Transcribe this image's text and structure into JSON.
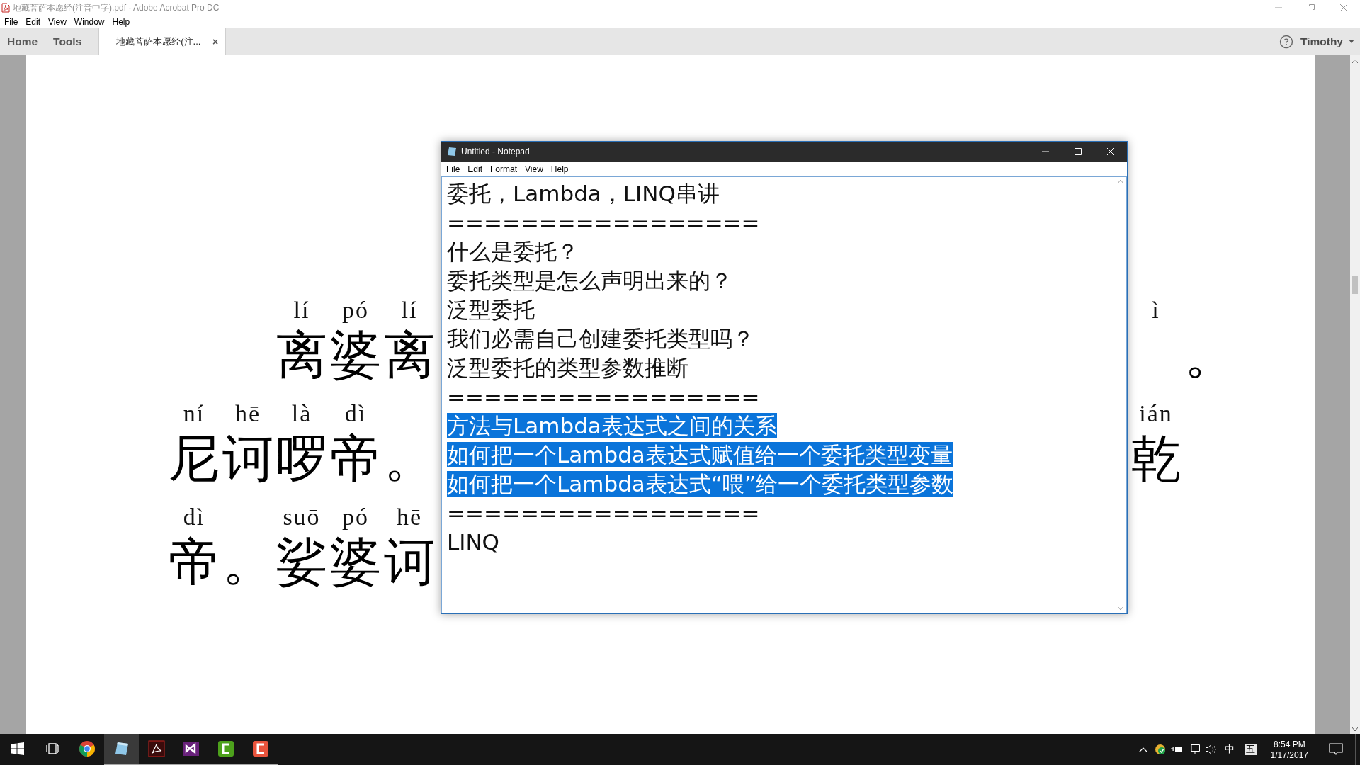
{
  "window": {
    "title": "地藏菩萨本愿经(注音中字).pdf - Adobe Acrobat Pro DC"
  },
  "menu": [
    "File",
    "Edit",
    "View",
    "Window",
    "Help"
  ],
  "nav_tabs": [
    {
      "label": "Home",
      "selected": false
    },
    {
      "label": "Tools",
      "selected": false
    }
  ],
  "doc_tab": {
    "label": "地藏菩萨本愿经(注...",
    "close": "×"
  },
  "account": {
    "name": "Timothy"
  },
  "pdf_page": {
    "left_rows": [
      {
        "cells": [
          {
            "pinyin": "lí",
            "hanzi": "离"
          },
          {
            "pinyin": "pó",
            "hanzi": "婆"
          },
          {
            "pinyin": "lí",
            "hanzi": "离"
          }
        ]
      },
      {
        "cells": [
          {
            "pinyin": "ní",
            "hanzi": "尼"
          },
          {
            "pinyin": "hē",
            "hanzi": "诃"
          },
          {
            "pinyin": "là",
            "hanzi": "啰"
          },
          {
            "pinyin": "dì",
            "hanzi": "帝"
          },
          {
            "hanzi": "。"
          }
        ]
      },
      {
        "cells": [
          {
            "pinyin": "dì",
            "hanzi": "帝"
          },
          {
            "hanzi": "。"
          },
          {
            "pinyin": "suō",
            "hanzi": "娑"
          },
          {
            "pinyin": "pó",
            "hanzi": "婆"
          },
          {
            "pinyin": "hē",
            "hanzi": "诃"
          }
        ]
      }
    ],
    "right_rows": [
      {
        "cells": [
          {
            "pinyin": "ì"
          },
          {
            "hanzi": "。"
          }
        ]
      },
      {
        "cells": [
          {
            "pinyin": "ián",
            "hanzi": "乾"
          }
        ]
      }
    ]
  },
  "notepad": {
    "title": "Untitled - Notepad",
    "menu": [
      "File",
      "Edit",
      "Format",
      "View",
      "Help"
    ],
    "lines": [
      {
        "text": "委托，Lambda，LINQ串讲",
        "selected": false
      },
      {
        "text": "=================",
        "selected": false
      },
      {
        "text": "什么是委托？",
        "selected": false
      },
      {
        "text": "委托类型是怎么声明出来的？",
        "selected": false
      },
      {
        "text": "泛型委托",
        "selected": false
      },
      {
        "text": "我们必需自己创建委托类型吗？",
        "selected": false
      },
      {
        "text": "泛型委托的类型参数推断",
        "selected": false
      },
      {
        "text": "=================",
        "selected": false
      },
      {
        "text": "方法与Lambda表达式之间的关系",
        "selected": true
      },
      {
        "text": "如何把一个Lambda表达式赋值给一个委托类型变量",
        "selected": true
      },
      {
        "text": "如何把一个Lambda表达式“喂”给一个委托类型参数",
        "selected": true
      },
      {
        "text": "=================",
        "selected": false
      },
      {
        "text": "LINQ",
        "selected": false
      }
    ]
  },
  "taskbar": {
    "apps": [
      {
        "kind": "start",
        "selected": false,
        "running": false
      },
      {
        "kind": "taskview",
        "selected": false,
        "running": false
      },
      {
        "kind": "chrome",
        "selected": false,
        "running": false
      },
      {
        "kind": "notepad",
        "selected": true,
        "running": true
      },
      {
        "kind": "acrobat",
        "selected": false,
        "running": true
      },
      {
        "kind": "visualstudio",
        "selected": false,
        "running": true
      },
      {
        "kind": "camtasia-green",
        "selected": false,
        "running": true
      },
      {
        "kind": "camtasia-red",
        "selected": false,
        "running": true
      }
    ],
    "tray": {
      "ime_language": "中",
      "input_mode": "五",
      "time": "8:54 PM",
      "date": "1/17/2017"
    }
  }
}
